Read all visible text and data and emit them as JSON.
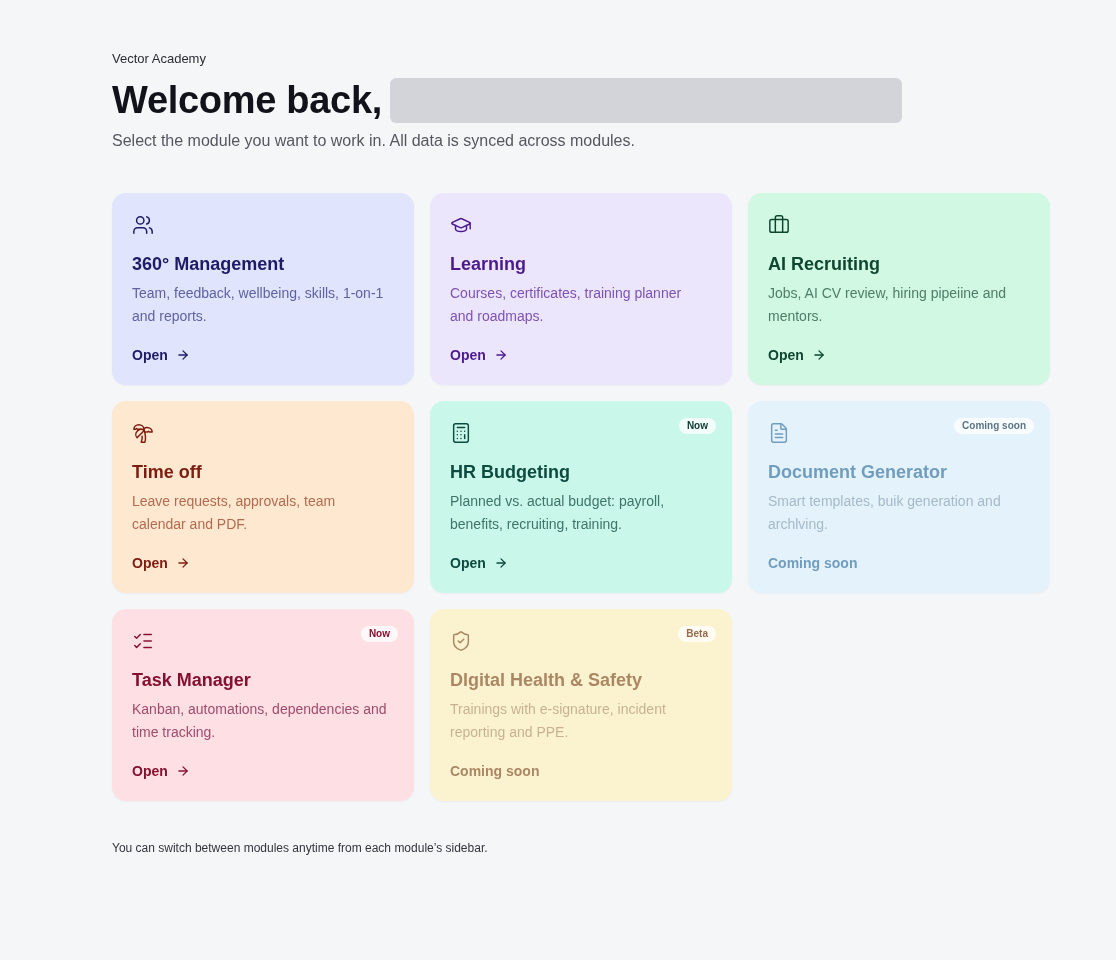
{
  "header": {
    "brand": "Vector Academy",
    "greeting": "Welcome back,",
    "subtitle": "Select the module you want to work in. All data is synced across modules."
  },
  "modules": [
    {
      "title": "360° Management",
      "description": "Team, feedback, wellbeing, skills, 1-on-1 and reports.",
      "action": "Open",
      "disabled": false
    },
    {
      "title": "Learning",
      "description": "Courses, certificates, training planner and roadmaps.",
      "action": "Open",
      "disabled": false
    },
    {
      "title": "AI Recruiting",
      "description": "Jobs, AI CV review, hiring pipeiine and mentors.",
      "action": "Open",
      "disabled": false
    },
    {
      "title": "Time off",
      "description": "Leave requests, approvals, team calendar and PDF.",
      "action": "Open",
      "disabled": false
    },
    {
      "title": "HR Budgeting",
      "description": "Planned vs. actual budget: payroll, benefits, recruiting, training.",
      "action": "Open",
      "disabled": false,
      "badge": "Now"
    },
    {
      "title": "Document Generator",
      "description": "Smart templates, buik generation and archlving.",
      "action": "Coming soon",
      "disabled": true,
      "badge": "Coming soon"
    },
    {
      "title": "Task Manager",
      "description": "Kanban, automations, dependencies and time tracking.",
      "action": "Open",
      "disabled": false,
      "badge": "Now"
    },
    {
      "title": "Dlgital Health & Safety",
      "description": "Trainings with e-signature, incident reporting and PPE.",
      "action": "Coming soon",
      "disabled": true,
      "badge": "Beta"
    }
  ],
  "footer": "You can switch between modules anytime from each module’s sidebar."
}
